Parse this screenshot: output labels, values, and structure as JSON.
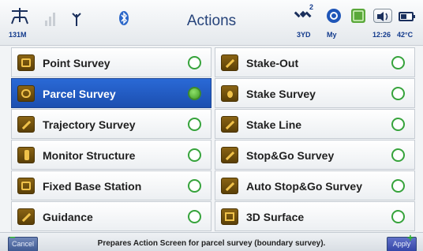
{
  "header": {
    "title": "Actions",
    "antenna_height": "131M",
    "satellites": "3YD",
    "sat_superscript": "2",
    "profile": "My",
    "time": "12:26",
    "temperature": "42°C"
  },
  "actions_left": [
    {
      "label": "Point Survey",
      "selected": false
    },
    {
      "label": "Parcel Survey",
      "selected": true
    },
    {
      "label": "Trajectory Survey",
      "selected": false
    },
    {
      "label": "Monitor Structure",
      "selected": false
    },
    {
      "label": "Fixed Base Station",
      "selected": false
    },
    {
      "label": "Guidance",
      "selected": false
    }
  ],
  "actions_right": [
    {
      "label": "Stake-Out",
      "selected": false
    },
    {
      "label": "Stake Survey",
      "selected": false
    },
    {
      "label": "Stake Line",
      "selected": false
    },
    {
      "label": "Stop&Go Survey",
      "selected": false
    },
    {
      "label": "Auto Stop&Go Survey",
      "selected": false
    },
    {
      "label": "3D Surface",
      "selected": false
    }
  ],
  "footer": {
    "cancel_label": "Cancel",
    "apply_label": "Apply",
    "hint": "Prepares Action Screen for parcel survey (boundary survey)."
  },
  "colors": {
    "selected_row": "#1c4fb0",
    "radio_green": "#36a33b",
    "icon_brown": "#6b4a0b",
    "title_blue": "#26437a"
  }
}
